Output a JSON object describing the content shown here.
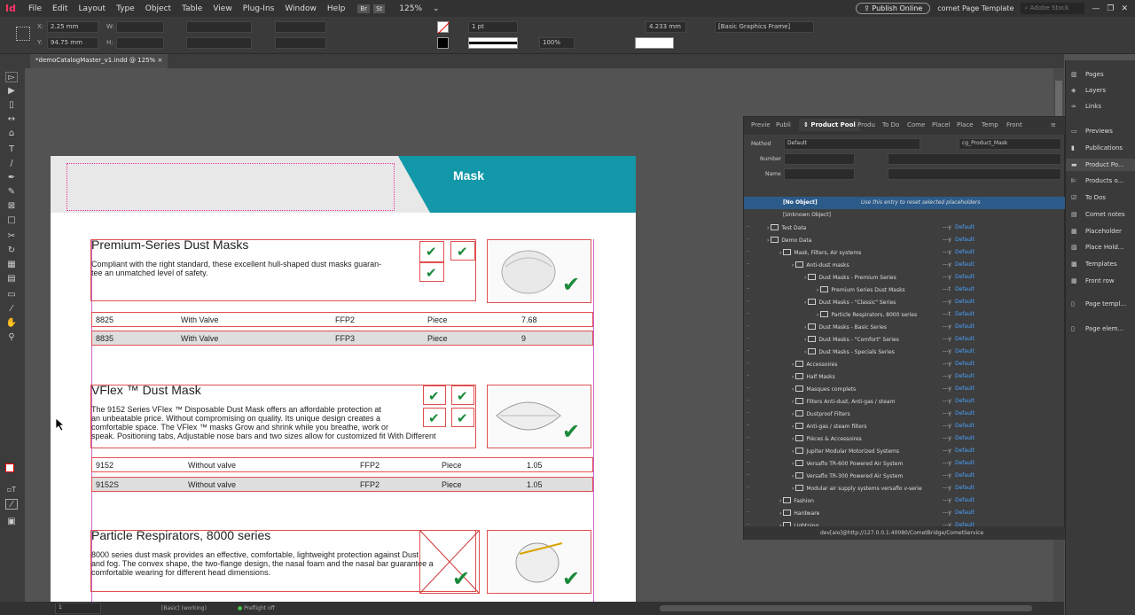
{
  "menubar": {
    "logo": "Id",
    "items": [
      "File",
      "Edit",
      "Layout",
      "Type",
      "Object",
      "Table",
      "View",
      "Plug-Ins",
      "Window",
      "Help"
    ],
    "br": "Br",
    "st": "St",
    "zoom": "125%",
    "publish": "Publish Online",
    "template": "comet Page Template",
    "search": "Adobe Stock"
  },
  "control": {
    "x_label": "X:",
    "x": "2.25 mm",
    "y_label": "Y:",
    "y": "94.75 mm",
    "w_label": "W:",
    "h_label": "H:",
    "stroke": "1 pt",
    "percent": "100%",
    "dim": "4.233 mm",
    "style": "[Basic Graphics Frame]"
  },
  "doc_tab": {
    "label": "*demoCatalogMaster_v1.indd @ 125%",
    "close": "×"
  },
  "header_title": "Mask",
  "products": [
    {
      "title": "Premium-Series Dust Masks",
      "body": [
        "Compliant with the right standard, these excellent hull-shaped dust masks guaran-",
        "tee an unmatched level of safety."
      ],
      "rows": [
        [
          "8825",
          "With Valve",
          "FFP2",
          "Piece",
          "7.68"
        ],
        [
          "8835",
          "With Valve",
          "FFP3",
          "Piece",
          "9"
        ]
      ]
    },
    {
      "title": "VFlex ™ Dust Mask",
      "body": [
        "The 9152 Series VFlex ™ Disposable Dust Mask offers an affordable protection at",
        "an unbeatable price. Without compromising on quality. Its unique design creates a",
        "comfortable space. The VFlex ™ masks Grow and shrink while you breathe, work or",
        "speak. Positioning tabs, Adjustable nose bars and two sizes allow for customized fit With Different"
      ],
      "rows": [
        [
          "9152",
          "Without valve",
          "FFP2",
          "Piece",
          "1.05"
        ],
        [
          "9152S",
          "Without valve",
          "FFP2",
          "Piece",
          "1.05"
        ]
      ]
    },
    {
      "title": "Particle Respirators, 8000 series",
      "body": [
        "8000 series dust mask provides an effective, comfortable, lightweight protection against Dust",
        "and fog. The convex shape, the two-flange design, the nasal foam and the nasal bar guarantee a",
        "comfortable wearing for different head dimensions."
      ],
      "rows": []
    }
  ],
  "panel": {
    "tabs": [
      "Previe",
      "Publi",
      "Product Pool",
      "Produ",
      "To Do",
      "Come",
      "Placel",
      "Place",
      "Temp",
      "Front"
    ],
    "method_label": "Method",
    "method": "Default",
    "cg": "cg_Product_Mask",
    "number_label": "Number",
    "name_label": "Name",
    "no_object": "[No Object]",
    "no_object_hint": "Use this entry to reset selected placeholders",
    "unknown": "[Unknown Object]",
    "tree": [
      {
        "label": "Test Data",
        "indent": 0,
        "status": "---y",
        "df": "Default"
      },
      {
        "label": "Demo Data",
        "indent": 0,
        "status": "---y",
        "df": "Default"
      },
      {
        "label": "Mask, Filters, Air systems",
        "indent": 1,
        "status": "---y",
        "df": "Default"
      },
      {
        "label": "Anti-dust masks",
        "indent": 2,
        "status": "---y",
        "df": "Default"
      },
      {
        "label": "Dust Masks - Premium Series",
        "indent": 3,
        "status": "---y",
        "df": "Default"
      },
      {
        "label": "Premium Series Dust Masks",
        "indent": 4,
        "status": "---t",
        "df": "Default"
      },
      {
        "label": "Dust Masks - \"Classic\" Series",
        "indent": 3,
        "status": "---y",
        "df": "Default"
      },
      {
        "label": "Particle Respirators, 8000 series",
        "indent": 4,
        "status": "---t",
        "df": "Default"
      },
      {
        "label": "Dust Masks - Basic Series",
        "indent": 3,
        "status": "---y",
        "df": "Default"
      },
      {
        "label": "Dust Masks - \"Comfort\" Series",
        "indent": 3,
        "status": "---y",
        "df": "Default"
      },
      {
        "label": "Dust Masks - Specials Series",
        "indent": 3,
        "status": "---y",
        "df": "Default"
      },
      {
        "label": "Accessoires",
        "indent": 2,
        "status": "---y",
        "df": "Default"
      },
      {
        "label": "Half Masks",
        "indent": 2,
        "status": "---y",
        "df": "Default"
      },
      {
        "label": "Masques complets",
        "indent": 2,
        "status": "---y",
        "df": "Default"
      },
      {
        "label": "Filters Anti-dust, Anti-gas / steam",
        "indent": 2,
        "status": "---y",
        "df": "Default"
      },
      {
        "label": "Dustproof Filters",
        "indent": 2,
        "status": "---y",
        "df": "Default"
      },
      {
        "label": "Anti-gas / steam filters",
        "indent": 2,
        "status": "---y",
        "df": "Default"
      },
      {
        "label": "Pièces & Accessoires",
        "indent": 2,
        "status": "---y",
        "df": "Default"
      },
      {
        "label": "Jupiter Modular Motorized Systems",
        "indent": 2,
        "status": "---y",
        "df": "Default"
      },
      {
        "label": "Versaflo TR-600 Powered Air System",
        "indent": 2,
        "status": "---y",
        "df": "Default"
      },
      {
        "label": "Versaflo TR-300 Powered Air System",
        "indent": 2,
        "status": "---y",
        "df": "Default"
      },
      {
        "label": "Modular air supply systems versaflo v-serie",
        "indent": 2,
        "status": "---y",
        "df": "Default"
      },
      {
        "label": "Fashion",
        "indent": 1,
        "status": "---y",
        "df": "Default"
      },
      {
        "label": "Hardware",
        "indent": 1,
        "status": "---y",
        "df": "Default"
      },
      {
        "label": "Lightning",
        "indent": 1,
        "status": "---y",
        "df": "Default"
      }
    ],
    "footer": "dev[aio]@http://127.0.0.1:40080/CometBridge/CometService"
  },
  "dock": [
    "Pages",
    "Layers",
    "Links",
    "Previews",
    "Publications",
    "Product Po...",
    "Products o...",
    "To Dos",
    "Comet notes",
    "Placeholder",
    "Place Hold...",
    "Templates",
    "Front row",
    "Page templ...",
    "Page elem..."
  ],
  "status": {
    "page": "1",
    "master": "[Basic] (working)",
    "preflight": "Preflight off"
  }
}
